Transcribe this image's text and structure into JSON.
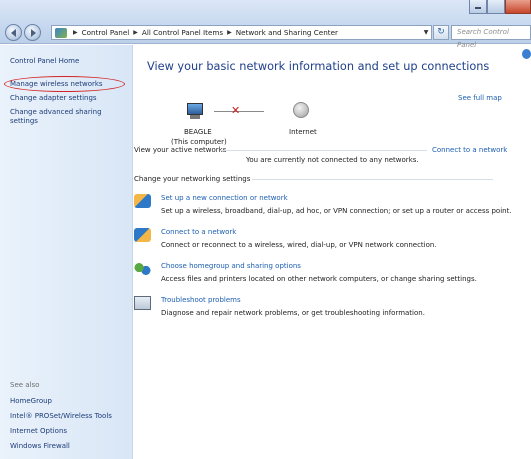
{
  "titlebar": {
    "buttons": [
      "minimize",
      "maximize",
      "close"
    ]
  },
  "address": {
    "crumbs": [
      "Control Panel",
      "All Control Panel Items",
      "Network and Sharing Center"
    ],
    "search_placeholder": "Search Control Panel"
  },
  "leftpane": {
    "home": "Control Panel Home",
    "links": [
      "Manage wireless networks",
      "Change adapter settings",
      "Change advanced sharing settings"
    ],
    "see_also_label": "See also",
    "see_also": [
      "HomeGroup",
      "Intel® PROSet/Wireless Tools",
      "Internet Options",
      "Windows Firewall"
    ]
  },
  "main": {
    "heading": "View your basic network information and set up connections",
    "see_full_map": "See full map",
    "computer_name": "BEAGLE",
    "computer_sub": "(This computer)",
    "internet_label": "Internet",
    "active_networks_label": "View your active networks",
    "connect_link": "Connect to a network",
    "not_connected": "You are currently not connected to any networks.",
    "settings_label": "Change your networking settings",
    "tasks": [
      {
        "link": "Set up a new connection or network",
        "desc": "Set up a wireless, broadband, dial-up, ad hoc, or VPN connection; or set up a router or access point."
      },
      {
        "link": "Connect to a network",
        "desc": "Connect or reconnect to a wireless, wired, dial-up, or VPN network connection."
      },
      {
        "link": "Choose homegroup and sharing options",
        "desc": "Access files and printers located on other network computers, or change sharing settings."
      },
      {
        "link": "Troubleshoot problems",
        "desc": "Diagnose and repair network problems, or get troubleshooting information."
      }
    ]
  },
  "colors": {
    "link": "#1c5fb2",
    "heading": "#1e3f8a",
    "annotation": "#d42323"
  }
}
